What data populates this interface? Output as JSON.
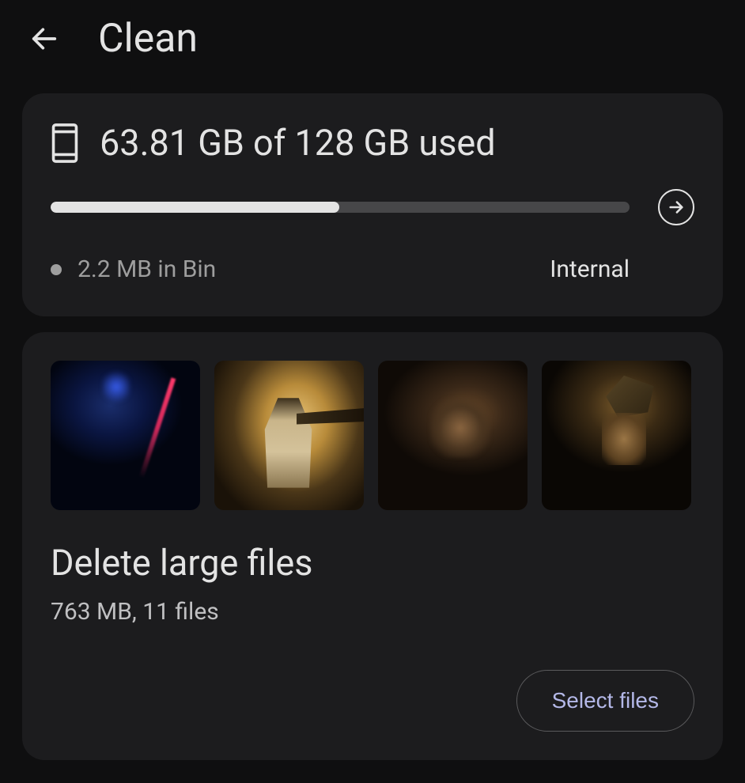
{
  "header": {
    "title": "Clean"
  },
  "storage": {
    "summary": "63.81 GB of 128 GB used",
    "used_gb": 63.81,
    "total_gb": 128,
    "percent": 49.85,
    "bin_text": "2.2 MB in Bin",
    "location": "Internal"
  },
  "large_files": {
    "title": "Delete large files",
    "subtitle": "763 MB, 11 files",
    "button": "Select files",
    "thumbnails": [
      {
        "name": "concert-photo-blue"
      },
      {
        "name": "concert-photo-suit"
      },
      {
        "name": "concert-photo-dark"
      },
      {
        "name": "concert-photo-cap"
      }
    ]
  }
}
